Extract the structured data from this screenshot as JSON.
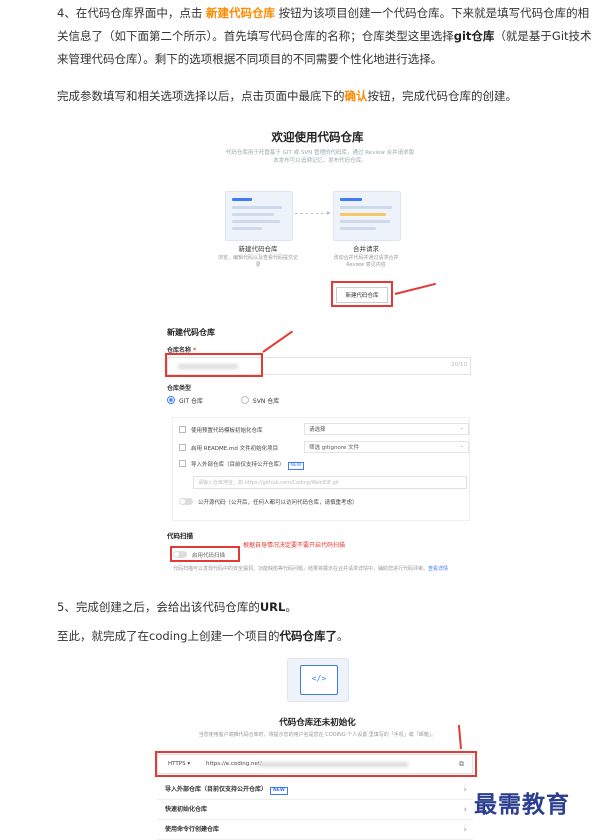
{
  "step4": {
    "prefix": "4、在代码仓库界面中，点击 ",
    "highlight": "新建代码仓库",
    "suffix_a": " 按钮为该项目创建一个代码仓库。下来就是填写代码仓库的相关信息了（如下面第二个所示）。首先填写代码仓库的名称；仓库类型这里选择",
    "git_bold": "git仓库",
    "suffix_b": "（就是基于Git技术来管理代码仓库）。剩下的选项根据不同项目的不同需要个性化地进行选择。"
  },
  "step4b": {
    "prefix": "完成参数填写和相关选项选择以后，点击页面中最底下的",
    "highlight": "确认",
    "suffix": "按钮，完成代码仓库的创建。"
  },
  "shot1": {
    "title": "欢迎使用代码仓库",
    "subtitle": "代码仓库用于托管基于 GIT 或 SVN 管理的代码库，通过 Review 合并请求版本发布可以追溯记忆，发布代码仓库。",
    "card_left_label": "新建代码仓库",
    "card_left_desc": "浏览、编辑代码以及查看代码提交记录",
    "card_right_label": "合并请求",
    "card_right_desc": "改动合并代码并通过请求合并 Review 意见内容",
    "new_button": "新建代码仓库",
    "form_heading": "新建代码仓库",
    "name_label": "仓库名称",
    "name_required": "*",
    "name_counter": "20/10",
    "type_label": "仓库类型",
    "type_git": "GIT 仓库",
    "type_svn": "SVN 仓库",
    "opt_template": "使用预置代码模板初始化仓库",
    "opt_template_select": "请选择",
    "opt_readme": "启用 README.md 文件初始化项目",
    "opt_gitignore_select": "筛选 gitignore 文件",
    "opt_import": "导入外部仓库（目前仅支持公开仓库）",
    "opt_import_tag": "NEW",
    "opt_import_placeholder": "请输入仓库地址，如 https://github.com/Coding/WebIDE.git",
    "opt_public": "公开源代码（公开后，任何人都可以访问代码仓库，请慎重考虑）",
    "scan_heading": "代码扫描",
    "scan_toggle": "启用代码扫描",
    "scan_note": "根据自身情况决定要不要开启代码扫描",
    "scan_desc": "代码扫描可以发现代码中的安全漏洞、功能缺陷等代码问题，结果将展示在合并请求详情中，辅助您进行代码评审。",
    "scan_link": "查看详情"
  },
  "step5": {
    "prefix": "5、完成创建之后，会给出该代码仓库的",
    "bold": "URL",
    "suffix": "。"
  },
  "conclusion": {
    "prefix": "至此，就完成了在coding上创建一个项目的",
    "bold": "代码仓库了",
    "suffix": "。"
  },
  "shot2": {
    "icon_code": "</>",
    "title": "代码仓库还未初始化",
    "subtitle": "当您使用客户端推代码仓库时，将提示您的用户名是您在 CODING 个人设置 里填写的「手机」或「邮箱」。",
    "protocol": "HTTPS ▾",
    "url": "https://e.coding.net/",
    "copy_icon": "⧉",
    "row_import": "导入外部仓库（目前仅支持公开仓库）",
    "row_import_tag": "NEW",
    "row_quick": "快速初始化仓库",
    "row_cmd": "使用命令行创建仓库"
  },
  "watermark": "最需教育"
}
